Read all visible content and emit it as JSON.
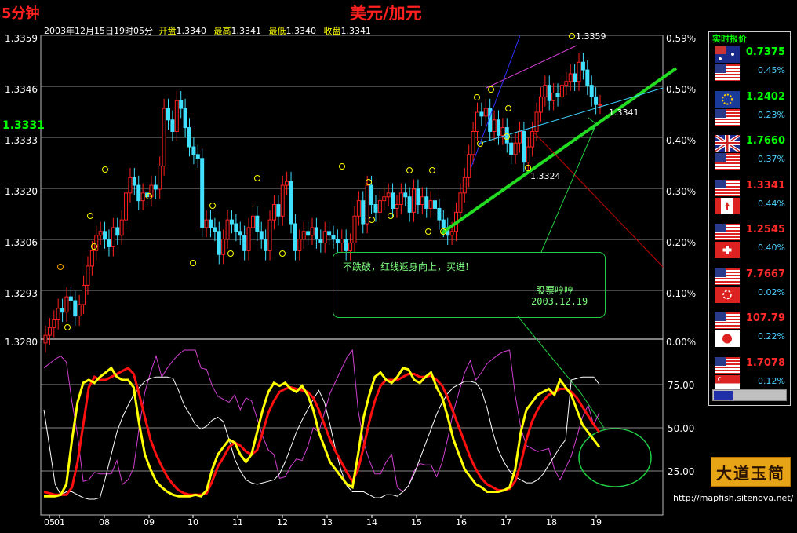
{
  "header": {
    "period": "5分钟",
    "title": "美元/加元",
    "info_time": "2003年12月15日19时05分",
    "open_label": "开盘",
    "open": "1.3340",
    "high_label": "最高",
    "high": "1.3341",
    "low_label": "最低",
    "low": "1.3340",
    "close_label": "收盘",
    "close": "1.3341"
  },
  "current_price": "1.3331",
  "price_axis": [
    "1.3359",
    "1.3346",
    "1.3333",
    "1.3320",
    "1.3306",
    "1.3293",
    "1.3280"
  ],
  "pct_axis": [
    "0.59%",
    "0.50%",
    "0.40%",
    "0.30%",
    "0.20%",
    "0.10%",
    "0.00%"
  ],
  "osc_axis": [
    "75.00",
    "50.00",
    "25.00"
  ],
  "x_ticks": [
    "05",
    "01",
    "08",
    "09",
    "10",
    "11",
    "12",
    "13",
    "14",
    "15",
    "16",
    "17",
    "18",
    "19"
  ],
  "annotations": {
    "high_label": "1.3359",
    "last_label": "1.3341",
    "low_label": "1.3324",
    "note_line1": "不跌破，红线返身向上，买进!",
    "note_sign": "股票哼哼",
    "note_date": "2003.12.19"
  },
  "quotes_panel": {
    "title": "实时报价",
    "items": [
      {
        "price": "0.7375",
        "pct": "0.45%",
        "price_color": "#00ff00",
        "flags": [
          "australia",
          "usa"
        ]
      },
      {
        "price": "1.2402",
        "pct": "0.23%",
        "price_color": "#00ff00",
        "flags": [
          "eu",
          "usa"
        ]
      },
      {
        "price": "1.7660",
        "pct": "0.37%",
        "price_color": "#00ff00",
        "flags": [
          "uk",
          "usa"
        ]
      },
      {
        "price": "1.3341",
        "pct": "0.44%",
        "price_color": "#ff2a2a",
        "flags": [
          "usa",
          "canada"
        ]
      },
      {
        "price": "1.2545",
        "pct": "0.40%",
        "price_color": "#ff2a2a",
        "flags": [
          "usa",
          "switzerland"
        ]
      },
      {
        "price": "7.7667",
        "pct": "0.02%",
        "price_color": "#ff2a2a",
        "flags": [
          "usa",
          "hongkong"
        ]
      },
      {
        "price": "107.79",
        "pct": "0.22%",
        "price_color": "#ff2a2a",
        "flags": [
          "usa",
          "japan"
        ]
      },
      {
        "price": "1.7078",
        "pct": "0.12%",
        "price_color": "#ff2a2a",
        "flags": [
          "usa",
          "singapore"
        ]
      }
    ]
  },
  "logo_text": "大道玉简",
  "footer_url": "http://mapfish.sitenova.net/",
  "colors": {
    "up": "#ff2020",
    "down": "#40e0ff",
    "trend": "#22dd22",
    "k": "#ffff00",
    "d": "#ff1010",
    "j": "#ffffff",
    "m": "#d040d0"
  },
  "chart_data": {
    "type": "candlestick",
    "ylim": [
      1.328,
      1.3359
    ],
    "close_series": [
      1.3281,
      1.3283,
      1.3285,
      1.3288,
      1.3287,
      1.3291,
      1.329,
      1.3286,
      1.3289,
      1.3294,
      1.3299,
      1.3303,
      1.3307,
      1.3308,
      1.3306,
      1.3304,
      1.3309,
      1.3307,
      1.3311,
      1.3318,
      1.3322,
      1.332,
      1.3316,
      1.3318,
      1.3317,
      1.332,
      1.3319,
      1.3325,
      1.334,
      1.3337,
      1.3334,
      1.3342,
      1.334,
      1.3335,
      1.333,
      1.3328,
      1.3327,
      1.3309,
      1.3311,
      1.3309,
      1.3308,
      1.3302,
      1.3306,
      1.3311,
      1.331,
      1.3308,
      1.3307,
      1.3303,
      1.3309,
      1.3312,
      1.3308,
      1.3306,
      1.3303,
      1.3311,
      1.3315,
      1.3312,
      1.332,
      1.3321,
      1.331,
      1.3303,
      1.3306,
      1.3308,
      1.3307,
      1.3309,
      1.3306,
      1.3305,
      1.3308,
      1.3307,
      1.3306,
      1.3305,
      1.3306,
      1.3303,
      1.3305,
      1.3312,
      1.3316,
      1.331,
      1.332,
      1.3315,
      1.3313,
      1.3316,
      1.3317,
      1.3318,
      1.3314,
      1.3315,
      1.3318,
      1.3317,
      1.3313,
      1.3319,
      1.3315,
      1.3317,
      1.3314,
      1.3316,
      1.3314,
      1.3311,
      1.3309,
      1.3307,
      1.3308,
      1.3313,
      1.3318,
      1.3322,
      1.3328,
      1.3334,
      1.3339,
      1.3338,
      1.334,
      1.3334,
      1.3337,
      1.3333,
      1.3335,
      1.3331,
      1.3328,
      1.3331,
      1.3334,
      1.3326,
      1.333,
      1.3334,
      1.3339,
      1.3343,
      1.3346,
      1.3342,
      1.3344,
      1.3343,
      1.3346,
      1.3347,
      1.3349,
      1.3347,
      1.3352,
      1.335,
      1.3346,
      1.3343,
      1.3341,
      1.3341
    ],
    "k_series": [
      2,
      2,
      2,
      3,
      10,
      40,
      65,
      78,
      80,
      78,
      82,
      85,
      88,
      82,
      80,
      80,
      75,
      50,
      30,
      20,
      12,
      8,
      5,
      3,
      2,
      2,
      2,
      3,
      2,
      6,
      20,
      30,
      35,
      40,
      38,
      30,
      25,
      30,
      45,
      60,
      72,
      78,
      76,
      78,
      74,
      72,
      76,
      70,
      60,
      45,
      35,
      25,
      20,
      15,
      10,
      8,
      30,
      55,
      70,
      82,
      85,
      80,
      78,
      82,
      88,
      87,
      80,
      78,
      82,
      85,
      75,
      68,
      55,
      40,
      30,
      20,
      15,
      10,
      8,
      5,
      5,
      5,
      6,
      8,
      20,
      45,
      60,
      65,
      70,
      72,
      74,
      70,
      80,
      75,
      70,
      60,
      50,
      45,
      40,
      35
    ],
    "d_series": [
      5,
      4,
      3,
      3,
      3,
      8,
      25,
      50,
      75,
      82,
      80,
      80,
      82,
      84,
      86,
      88,
      84,
      70,
      55,
      40,
      30,
      22,
      15,
      10,
      6,
      4,
      3,
      3,
      3,
      4,
      12,
      22,
      28,
      35,
      38,
      36,
      32,
      30,
      33,
      45,
      58,
      66,
      72,
      74,
      75,
      74,
      73,
      72,
      68,
      60,
      50,
      40,
      32,
      25,
      18,
      12,
      20,
      35,
      52,
      66,
      76,
      80,
      80,
      80,
      82,
      84,
      84,
      82,
      82,
      83,
      80,
      76,
      68,
      58,
      48,
      38,
      28,
      20,
      14,
      10,
      8,
      6,
      6,
      7,
      12,
      24,
      40,
      52,
      60,
      66,
      70,
      72,
      74,
      74,
      72,
      68,
      62,
      56,
      50,
      45
    ]
  }
}
